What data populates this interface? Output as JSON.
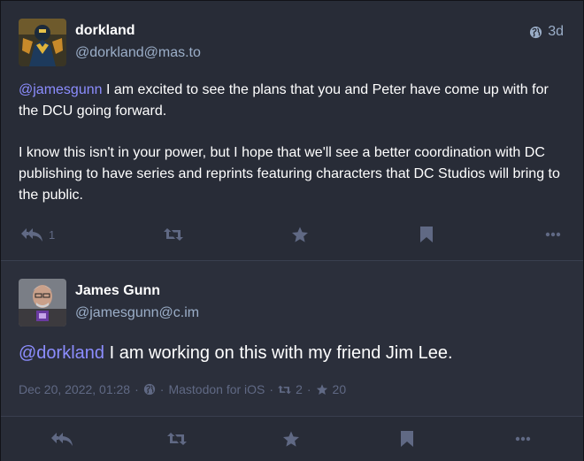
{
  "post1": {
    "display_name": "dorkland",
    "acct": "@dorkland@mas.to",
    "relative_time": "3d",
    "mention": "@jamesgunn",
    "paragraph1_rest": " I am excited to see the plans that you and Peter have come up with for the DCU going forward.",
    "paragraph2": "I know this isn't in your power, but I hope that we'll see a better coordination with DC publishing to have series and reprints featuring characters that DC Studios will bring to the public.",
    "reply_count": "1"
  },
  "post2": {
    "display_name": "James Gunn",
    "acct": "@jamesgunn@c.im",
    "mention": "@dorkland",
    "content_rest": " I am working on this with my friend Jim Lee.",
    "date": "Dec 20, 2022, 01:28",
    "sep1": "·",
    "sep2": "·",
    "application": "Mastodon for iOS",
    "sep3": "·",
    "boost_count": "2",
    "sep4": "·",
    "favourite_count": "20"
  },
  "icons": {
    "reply": "reply-all-icon",
    "boost": "retweet-icon",
    "favourite": "star-icon",
    "bookmark": "bookmark-icon",
    "more": "ellipsis-icon",
    "visibility": "globe-icon"
  },
  "colors": {
    "background": "#282c37",
    "text": "#ffffff",
    "secondary": "#9baec8",
    "muted": "#606984",
    "mention": "#8c8dff"
  }
}
